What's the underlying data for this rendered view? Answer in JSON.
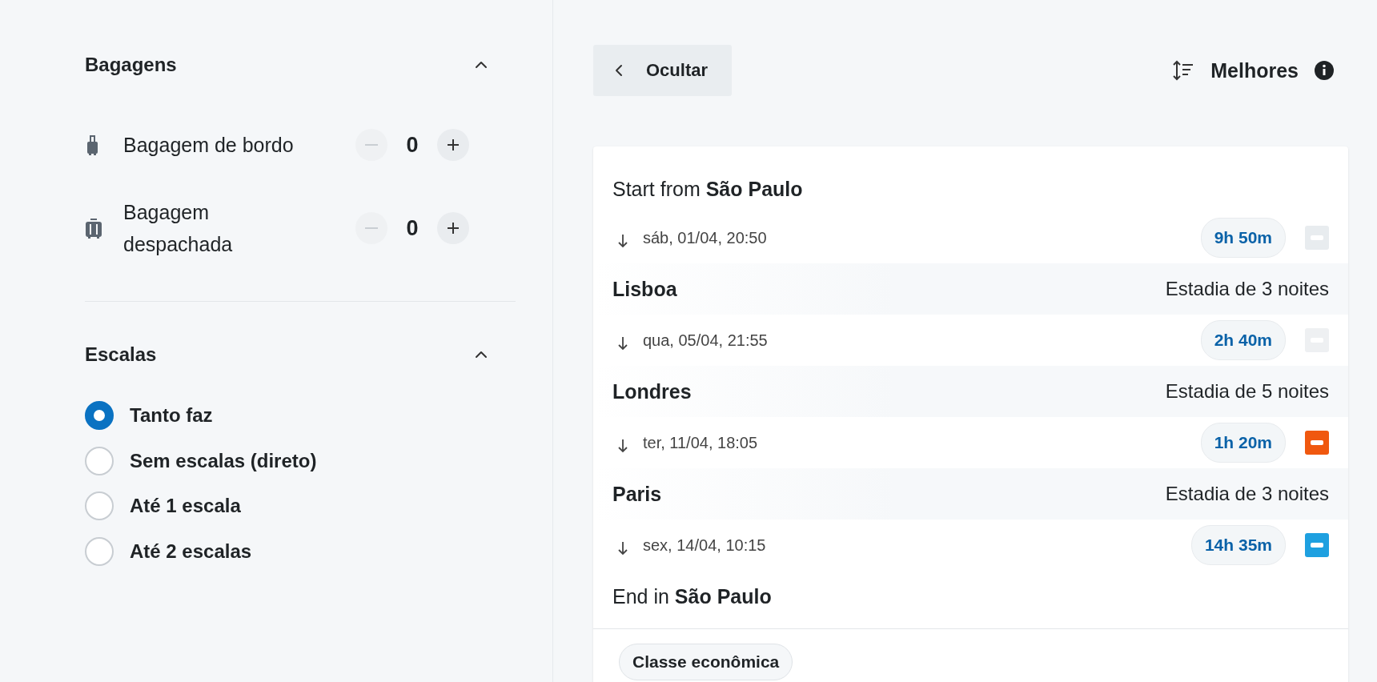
{
  "sidebar": {
    "sections": [
      {
        "title": "Bagagens",
        "expanded": true,
        "kind": "steppers",
        "items": [
          {
            "label": "Bagagem de bordo",
            "value": "0",
            "minus_disabled": true
          },
          {
            "label": "Bagagem despachada",
            "value": "0",
            "minus_disabled": true
          }
        ]
      },
      {
        "title": "Escalas",
        "expanded": true,
        "kind": "radios",
        "items": [
          {
            "label": "Tanto faz",
            "selected": true
          },
          {
            "label": "Sem escalas (direto)",
            "selected": false
          },
          {
            "label": "Até 1 escala",
            "selected": false
          },
          {
            "label": "Até 2 escalas",
            "selected": false
          }
        ]
      }
    ]
  },
  "toolbar": {
    "hide_button": "Ocultar",
    "sort_label": "Melhores"
  },
  "itinerary": {
    "start": "Start from **São Paulo**",
    "items": [
      {
        "kind": "flight",
        "date": "sáb, 01/04, 20:50",
        "duration": "9h 50m",
        "color": "#e8ecef"
      },
      {
        "kind": "stop",
        "city": "Lisboa",
        "stay": "Estadia de 3 noites"
      },
      {
        "kind": "flight",
        "date": "qua, 05/04, 21:55",
        "duration": "2h 40m",
        "color": "#eef0f2"
      },
      {
        "kind": "stop",
        "city": "Londres",
        "stay": "Estadia de 5 noites"
      },
      {
        "kind": "flight",
        "date": "ter, 11/04, 18:05",
        "duration": "1h 20m",
        "color": "#f0580f"
      },
      {
        "kind": "stop",
        "city": "Paris",
        "stay": "Estadia de 3 noites"
      },
      {
        "kind": "flight",
        "date": "sex, 14/04, 10:15",
        "duration": "14h 35m",
        "color": "#1ea0e0"
      }
    ],
    "end": "End in **São Paulo**",
    "cabin": "Classe econômica"
  }
}
